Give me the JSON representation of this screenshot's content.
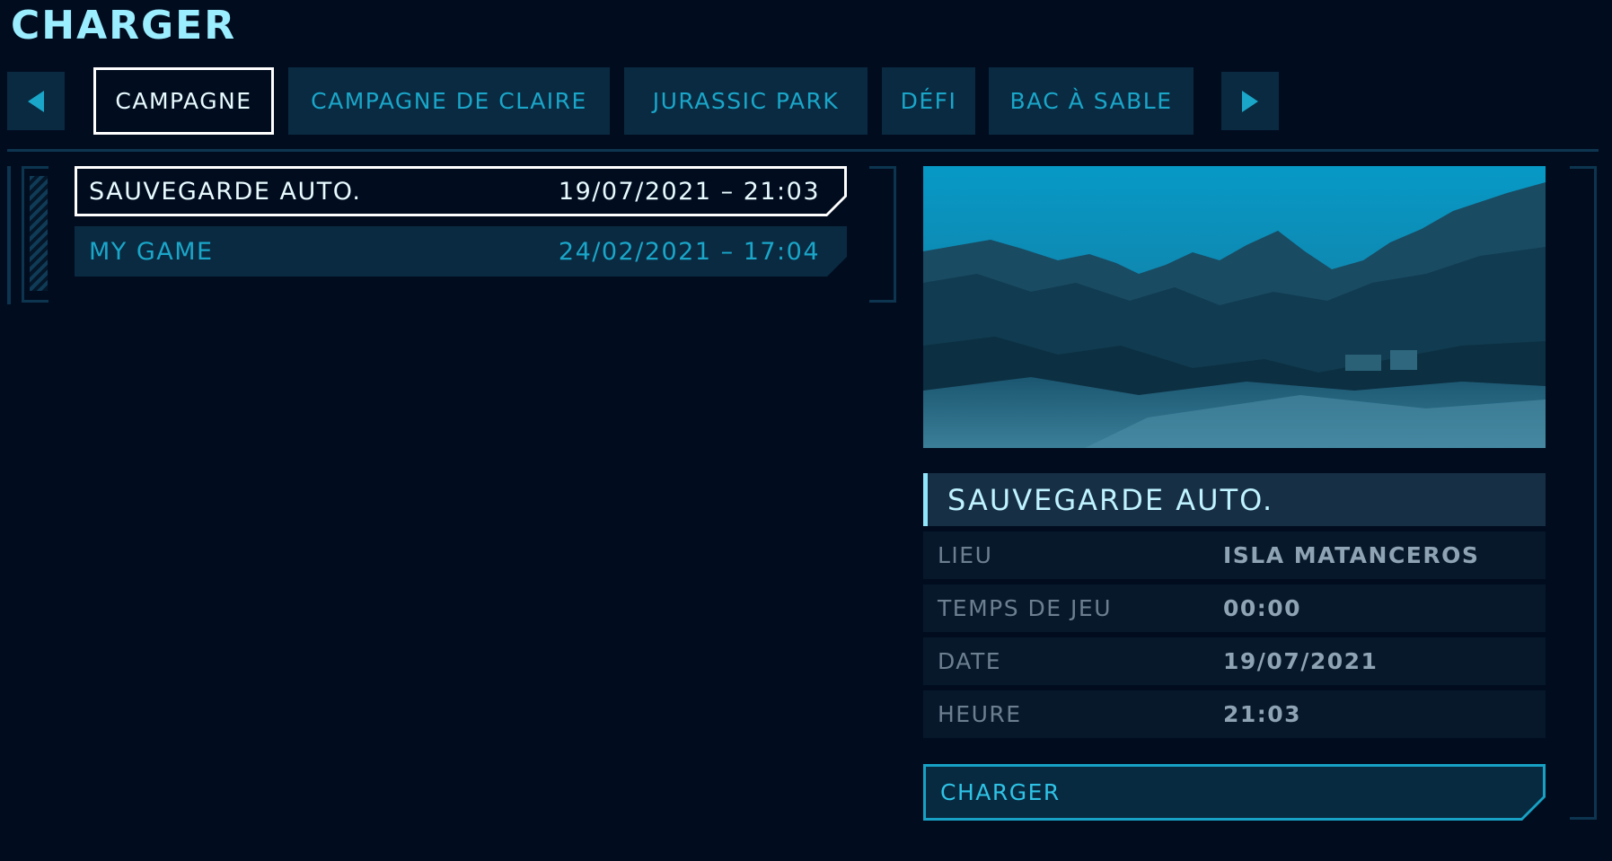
{
  "header": {
    "title": "CHARGER"
  },
  "tabs": [
    {
      "label": "CAMPAGNE",
      "active": true
    },
    {
      "label": "CAMPAGNE DE CLAIRE",
      "active": false
    },
    {
      "label": "JURASSIC PARK",
      "active": false
    },
    {
      "label": "DÉFI",
      "active": false
    },
    {
      "label": "BAC À SABLE",
      "active": false
    }
  ],
  "saves": [
    {
      "name": "SAUVEGARDE AUTO.",
      "datetime": "19/07/2021 – 21:03",
      "selected": true
    },
    {
      "name": "MY GAME",
      "datetime": "24/02/2021 – 17:04",
      "selected": false
    }
  ],
  "details": {
    "title": "SAUVEGARDE AUTO.",
    "rows": [
      {
        "label": "LIEU",
        "value": "ISLA MATANCEROS"
      },
      {
        "label": "TEMPS DE JEU",
        "value": "00:00"
      },
      {
        "label": "DATE",
        "value": "19/07/2021"
      },
      {
        "label": "HEURE",
        "value": "21:03"
      }
    ]
  },
  "actions": {
    "load_label": "CHARGER"
  },
  "colors": {
    "background": "#010c1f",
    "accent": "#1aa6c9",
    "title": "#9beeff",
    "panel": "#0a2a41"
  },
  "icons": {
    "prev": "chevron-left-icon",
    "next": "chevron-right-icon"
  }
}
